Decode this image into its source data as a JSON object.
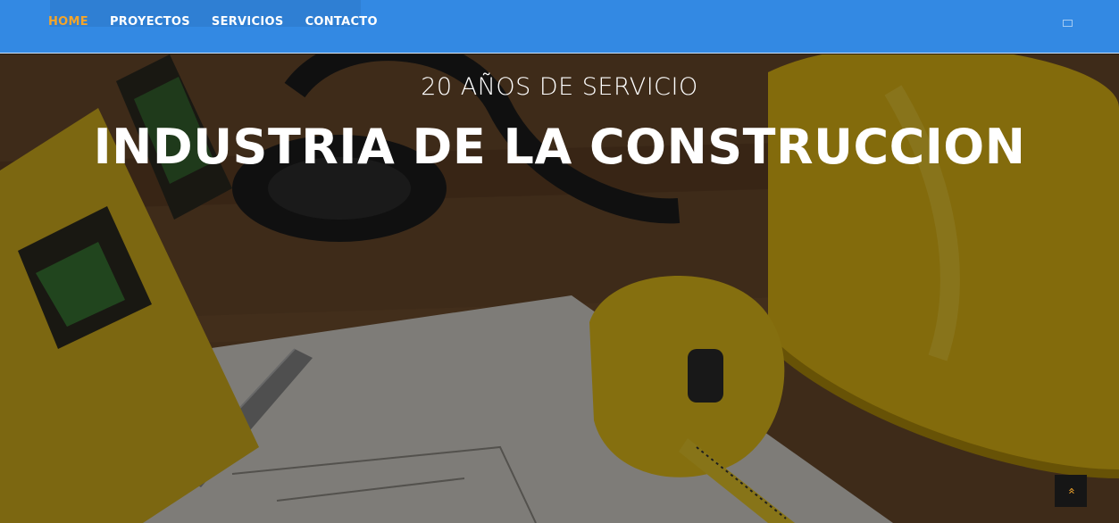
{
  "nav": {
    "items": [
      {
        "label": "HOME",
        "active": true
      },
      {
        "label": "PROYECTOS",
        "active": false
      },
      {
        "label": "SERVICIOS",
        "active": false
      },
      {
        "label": "CONTACTO",
        "active": false
      }
    ],
    "menu_icon": "menu-square-icon"
  },
  "hero": {
    "subtitle": "20 AÑOS DE SERVICIO",
    "title": "INDUSTRIA DE LA CONSTRUCCION"
  },
  "back_to_top": {
    "icon": "double-chevron-up-icon",
    "glyph": "«"
  },
  "colors": {
    "header_bg": "#3389e3",
    "accent": "#f4a52a",
    "back_to_top_bg": "#161616"
  }
}
